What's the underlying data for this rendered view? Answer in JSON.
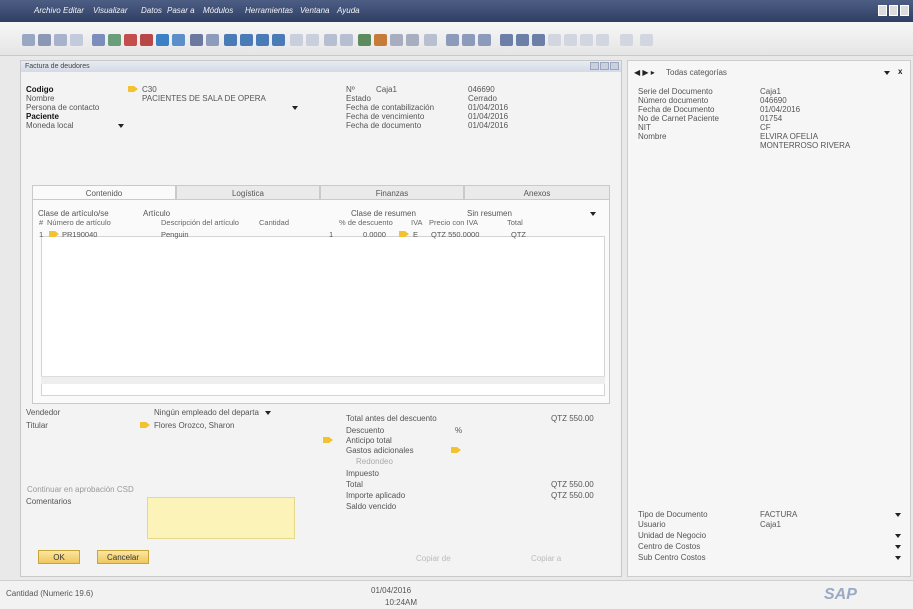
{
  "menubar": {
    "items": [
      "Archivo",
      "Editar",
      "Visualizar",
      "Datos",
      "Pasar a",
      "Módulos",
      "Herramientas",
      "Ventana",
      "Ayuda"
    ]
  },
  "form": {
    "title": "Factura de deudores",
    "left_fields": [
      {
        "label": "Codigo",
        "value": "C30",
        "bold": true
      },
      {
        "label": "Nombre",
        "value": "PACIENTES DE SALA DE OPERA",
        "bold": false
      },
      {
        "label": "Persona de contacto",
        "value": "",
        "bold": false
      },
      {
        "label": "Paciente",
        "value": "",
        "bold": true
      },
      {
        "label": "Moneda local",
        "value": "",
        "bold": false
      }
    ],
    "number": {
      "label": "Nº",
      "series": "Caja1",
      "value": "046690"
    },
    "right_fields": [
      {
        "label": "Estado",
        "value": "Cerrado"
      },
      {
        "label": "Fecha de contabilización",
        "value": "01/04/2016"
      },
      {
        "label": "Fecha de vencimiento",
        "value": "01/04/2016"
      },
      {
        "label": "Fecha de documento",
        "value": "01/04/2016"
      }
    ],
    "tabs": [
      "Contenido",
      "Logística",
      "Finanzas",
      "Anexos"
    ],
    "item_class": {
      "label": "Clase de artículo/se",
      "value": "Artículo"
    },
    "summary_class": {
      "label": "Clase de resumen",
      "value": "Sin resumen"
    },
    "columns": [
      "#",
      "Número de artículo",
      "Descripción del artículo",
      "Cantidad",
      "% de descuento",
      "IVA",
      "Precio con IVA",
      "Total"
    ],
    "rows": [
      {
        "num": "1",
        "code": "PR190040",
        "desc": "Penguin",
        "qty": "1",
        "discount": "0.0000",
        "tax": "E",
        "price": "QTZ 550.0000",
        "total": "QTZ"
      }
    ],
    "vendedor": {
      "label": "Vendedor",
      "value": "Ningún empleado del departa"
    },
    "titular": {
      "label": "Titular",
      "value": "Flores Orozco, Sharon"
    },
    "continue_label": "Continuar en aprobación CSD",
    "comments_label": "Comentarios",
    "totals": [
      {
        "label": "Total antes del descuento",
        "value": "QTZ 550.00"
      },
      {
        "label": "Descuento",
        "value": "%"
      },
      {
        "label": "Anticipo total",
        "value": ""
      },
      {
        "label": "Gastos adicionales",
        "value": ""
      },
      {
        "label": "Redondeo",
        "value": ""
      },
      {
        "label": "Impuesto",
        "value": ""
      },
      {
        "label": "Total",
        "value": "QTZ 550.00"
      },
      {
        "label": "Importe aplicado",
        "value": "QTZ 550.00"
      },
      {
        "label": "Saldo vencido",
        "value": ""
      }
    ],
    "ok_label": "OK",
    "cancel_label": "Cancelar",
    "bottom_links": [
      "Copiar de",
      "Copiar a"
    ]
  },
  "right_panel": {
    "category_label": "Todas categorías",
    "fields": [
      {
        "label": "Serie del Documento",
        "value": "Caja1"
      },
      {
        "label": "Número documento",
        "value": "046690"
      },
      {
        "label": "Fecha de Documento",
        "value": "01/04/2016"
      },
      {
        "label": "No de Carnet Paciente",
        "value": "01754"
      },
      {
        "label": "NIT",
        "value": "CF"
      },
      {
        "label": "Nombre",
        "value": "ELVIRA OFELIA MONTERROSO RIVERA"
      }
    ],
    "bottom_fields": [
      {
        "label": "Tipo de Documento",
        "value": "FACTURA"
      },
      {
        "label": "Usuario",
        "value": "Caja1"
      },
      {
        "label": "Unidad de Negocio",
        "value": ""
      },
      {
        "label": "Centro de Costos",
        "value": ""
      },
      {
        "label": "Sub Centro Costos",
        "value": ""
      }
    ]
  },
  "statusbar": {
    "left": "Cantidad (Numeric 19.6)",
    "date": "01/04/2016",
    "time": "10:24AM",
    "logo": "SAP"
  }
}
